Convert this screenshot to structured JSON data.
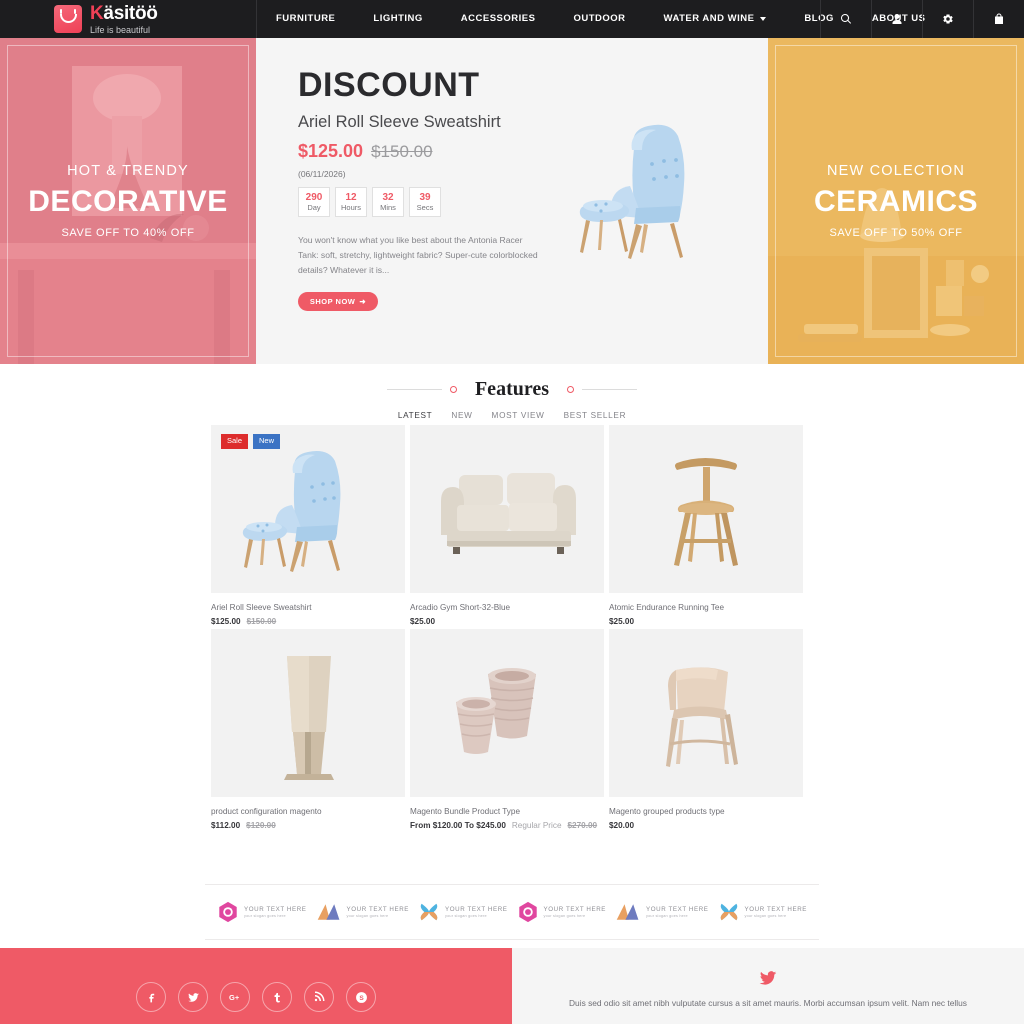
{
  "header": {
    "logo": {
      "name_part1": "K",
      "name_part2": "äsitöö",
      "full_name": "Käsitöö",
      "tagline": "Life is beautiful",
      "icon": "smiley-bag-icon"
    },
    "nav": [
      {
        "label": "FURNITURE",
        "dropdown": false
      },
      {
        "label": "LIGHTING",
        "dropdown": false
      },
      {
        "label": "ACCESSORIES",
        "dropdown": false
      },
      {
        "label": "OUTDOOR",
        "dropdown": false
      },
      {
        "label": "WATER AND WINE",
        "dropdown": true
      },
      {
        "label": "BLOG",
        "dropdown": false
      },
      {
        "label": "ABOUT US",
        "dropdown": false
      }
    ],
    "icons": [
      {
        "name": "search-icon"
      },
      {
        "name": "user-icon"
      },
      {
        "name": "gear-icon"
      },
      {
        "name": "cart-icon"
      }
    ]
  },
  "promo_left": {
    "top": "HOT & TRENDY",
    "title": "DECORATIVE",
    "sub": "SAVE OFF TO 40% OFF",
    "color": "#e8868f"
  },
  "promo_right": {
    "top": "NEW COLECTION",
    "title": "CERAMICS",
    "sub": "SAVE OFF TO 50% OFF",
    "color": "#edbb63"
  },
  "hero": {
    "title": "DISCOUNT",
    "product": "Ariel Roll Sleeve Sweatshirt",
    "price_now": "$125.00",
    "price_old": "$150.00",
    "date": "(06/11/2026)",
    "countdown": [
      {
        "num": "290",
        "label": "Day"
      },
      {
        "num": "12",
        "label": "Hours"
      },
      {
        "num": "32",
        "label": "Mins"
      },
      {
        "num": "39",
        "label": "Secs"
      }
    ],
    "description": "You won't know what you like best about the Antonia Racer Tank: soft, stretchy, lightweight fabric? Super-cute colorblocked details? Whatever it is...",
    "button": "SHOP NOW",
    "button_arrow": "➜",
    "image": "blue-armchair-with-ottoman"
  },
  "features": {
    "title": "Features",
    "tabs": [
      {
        "label": "LATEST",
        "active": true
      },
      {
        "label": "NEW",
        "active": false
      },
      {
        "label": "MOST VIEW",
        "active": false
      },
      {
        "label": "BEST SELLER",
        "active": false
      }
    ]
  },
  "products": [
    {
      "name": "Ariel Roll Sleeve Sweatshirt",
      "price": "$125.00",
      "price_old": "$150.00",
      "price_label": "",
      "badges": [
        {
          "text": "Sale",
          "type": "sale"
        },
        {
          "text": "New",
          "type": "new"
        }
      ],
      "image": "blue-armchair-ottoman"
    },
    {
      "name": "Arcadio Gym Short-32-Blue",
      "price": "$25.00",
      "price_old": "",
      "price_label": "",
      "badges": [],
      "image": "cream-sofa"
    },
    {
      "name": "Atomic Endurance Running Tee",
      "price": "$25.00",
      "price_old": "",
      "price_label": "",
      "badges": [],
      "image": "wooden-chair"
    },
    {
      "name": "product configuration magento",
      "price": "$112.00",
      "price_old": "$120.00",
      "price_label": "",
      "badges": [],
      "image": "beige-floor-lamp"
    },
    {
      "name": "Magento Bundle Product Type",
      "price": "From $120.00 To $245.00",
      "price_old": "$270.00",
      "price_label": "Regular Price",
      "badges": [],
      "image": "ceramic-planters"
    },
    {
      "name": "Magento grouped products type",
      "price": "$20.00",
      "price_old": "",
      "price_label": "",
      "badges": [],
      "image": "leather-lounge-chair"
    }
  ],
  "brands": [
    {
      "logo": "hexagon-logo",
      "text1": "YOUR TEXT HERE",
      "text2": "your slogan goes here"
    },
    {
      "logo": "arrow-logo",
      "text1": "YOUR TEXT HERE",
      "text2": "your slogan goes here"
    },
    {
      "logo": "cross-logo",
      "text1": "YOUR TEXT HERE",
      "text2": "your slogan goes here"
    },
    {
      "logo": "hexagon-logo",
      "text1": "YOUR TEXT HERE",
      "text2": "your slogan goes here"
    },
    {
      "logo": "arrow-logo",
      "text1": "YOUR TEXT HERE",
      "text2": "your slogan goes here"
    },
    {
      "logo": "cross-logo",
      "text1": "YOUR TEXT HERE",
      "text2": "your slogan goes here"
    }
  ],
  "footer": {
    "social": [
      {
        "name": "facebook-icon",
        "glyph": "f"
      },
      {
        "name": "twitter-icon",
        "glyph": "t"
      },
      {
        "name": "google-plus-icon",
        "glyph": "G+"
      },
      {
        "name": "tumblr-icon",
        "glyph": "t"
      },
      {
        "name": "rss-icon",
        "glyph": "rss"
      },
      {
        "name": "skype-icon",
        "glyph": "S"
      }
    ],
    "tweet": {
      "icon": "twitter-bird-icon",
      "text": "Duis sed odio sit amet nibh vulputate cursus a sit amet mauris. Morbi accumsan ipsum velit. Nam nec tellus"
    }
  },
  "colors": {
    "accent": "#ef5a66",
    "dark": "#1d1d1f",
    "sale": "#dd2c2c",
    "new": "#3b73c4",
    "promo_yellow": "#edbb63",
    "promo_pink": "#e8868f"
  }
}
